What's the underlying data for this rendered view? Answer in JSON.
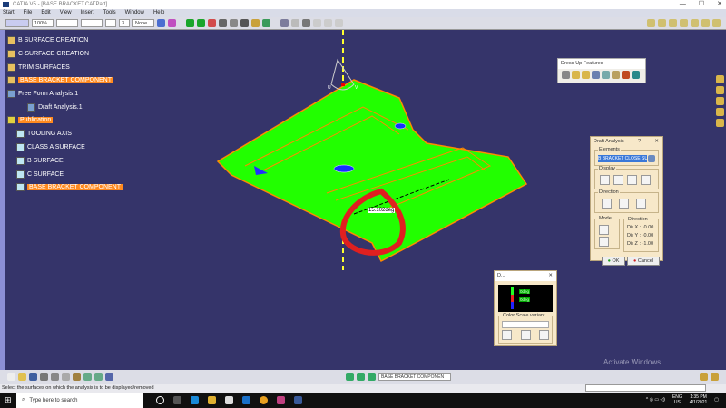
{
  "window": {
    "title": "CATIA V5 - [BASE BRACKET.CATPart]",
    "minimize": "—",
    "maximize": "☐",
    "close": "✕"
  },
  "menu": [
    "Start",
    "File",
    "Edit",
    "View",
    "Insert",
    "Tools",
    "Window",
    "Help"
  ],
  "toolbar": {
    "zoom": "100%",
    "layer": "None",
    "count": "3"
  },
  "tree": {
    "items": [
      {
        "label": "B SURFACE CREATION",
        "highlight": false,
        "type": "geo"
      },
      {
        "label": "C-SURFACE CREATION",
        "highlight": false,
        "type": "geo"
      },
      {
        "label": "TRIM SURFACES",
        "highlight": false,
        "type": "geo"
      },
      {
        "label": "BASE BRACKET COMPONENT",
        "highlight": true,
        "type": "geo"
      },
      {
        "label": "Free Form Analysis.1",
        "highlight": false,
        "type": "analysis"
      },
      {
        "label": "Draft Analysis.1",
        "highlight": false,
        "type": "analysis"
      },
      {
        "label": "Publication",
        "highlight": true,
        "type": "pub"
      },
      {
        "label": "TOOLING AXIS",
        "highlight": false,
        "type": "pub"
      },
      {
        "label": "CLASS A SURFACE",
        "highlight": false,
        "type": "pub"
      },
      {
        "label": "B SURFACE",
        "highlight": false,
        "type": "pub"
      },
      {
        "label": "C SURFACE",
        "highlight": false,
        "type": "pub"
      },
      {
        "label": "BASE BRACKET COMPONENT",
        "highlight": true,
        "type": "pub"
      }
    ]
  },
  "viewport": {
    "angle_label": "15.102deg",
    "compass_labels": [
      "U",
      "V"
    ]
  },
  "dressup": {
    "title": "Dress-Up Features"
  },
  "draft": {
    "title": "Draft Analysis",
    "help": "?",
    "close": "✕",
    "elements_label": "Elements",
    "elements_value": "B BRACKET CLOSE SURFA",
    "display_label": "Display",
    "direction_label": "Direction",
    "mode_label": "Mode",
    "dir_label": "Direction",
    "dirx": "Dir X :  -0.00",
    "diry": "Dir Y :  -0.00",
    "dirz": "Dir Z :  -1.00",
    "ok": "OK",
    "cancel": "Cancel"
  },
  "colorscale": {
    "title": "D...",
    "variant_label": "Color Scale variant",
    "close": "✕",
    "val1": "0deg",
    "val2": "0deg"
  },
  "bottom": {
    "combo": "BASE BRACKET COMPONEN"
  },
  "status": {
    "text": "Select the surfaces on which the analysis is to be displayed/removed"
  },
  "watermark": "Activate Windows",
  "taskbar": {
    "search": "Type here to search",
    "lang": "ENG",
    "region": "US",
    "time": "1:35 PM",
    "date": "4/1/2021"
  }
}
